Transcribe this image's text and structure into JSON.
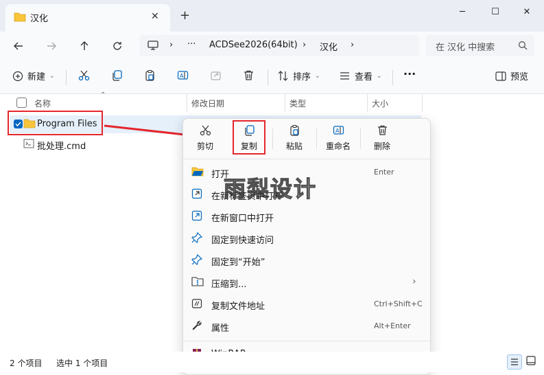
{
  "window": {
    "tab_title": "汉化",
    "tab_close": "✕",
    "new_tab": "+",
    "minimize": "─",
    "maximize": "☐",
    "close": "✕"
  },
  "address": {
    "more": "···",
    "crumbs": [
      "ACDSee2026(64bit)",
      "汉化"
    ],
    "search_placeholder": "在 汉化 中搜索"
  },
  "toolbar": {
    "new_label": "新建",
    "sort_label": "排序",
    "view_label": "查看",
    "more": "···",
    "preview_label": "预览"
  },
  "columns": [
    "名称",
    "修改日期",
    "类型",
    "大小"
  ],
  "files": [
    {
      "name": "Program Files",
      "icon": "folder-icon",
      "selected": true
    },
    {
      "name": "批处理.cmd",
      "icon": "cmd-file-icon",
      "selected": false
    }
  ],
  "context_menu": {
    "quick_actions": [
      {
        "label": "剪切",
        "icon": "scissors-icon"
      },
      {
        "label": "复制",
        "icon": "copy-icon"
      },
      {
        "label": "粘贴",
        "icon": "paste-icon"
      },
      {
        "label": "重命名",
        "icon": "rename-icon"
      },
      {
        "label": "删除",
        "icon": "trash-icon"
      }
    ],
    "items": [
      {
        "label": "打开",
        "shortcut": "Enter",
        "icon": "folder-open-icon"
      },
      {
        "label": "在新标签页中打开",
        "shortcut": "",
        "icon": "new-tab-icon"
      },
      {
        "label": "在新窗口中打开",
        "shortcut": "",
        "icon": "new-window-icon"
      },
      {
        "label": "固定到快速访问",
        "shortcut": "",
        "icon": "pin-icon"
      },
      {
        "label": "固定到“开始”",
        "shortcut": "",
        "icon": "pin-start-icon"
      },
      {
        "label": "压缩到...",
        "shortcut": "",
        "icon": "zip-icon",
        "submenu": true
      },
      {
        "label": "复制文件地址",
        "shortcut": "Ctrl+Shift+C",
        "icon": "copy-path-icon"
      },
      {
        "label": "属性",
        "shortcut": "Alt+Enter",
        "icon": "wrench-icon"
      }
    ],
    "winrar": {
      "label": "WinRAR",
      "icon": "winrar-icon",
      "submenu": true
    }
  },
  "status": {
    "count": "2 个项目",
    "selected": "选中 1 个项目"
  },
  "watermark": "雨梨设计",
  "colors": {
    "accent": "#0067c0",
    "folder": "#f8c43a",
    "annotation_red": "#e4262c",
    "selection": "#e5f0fb"
  }
}
